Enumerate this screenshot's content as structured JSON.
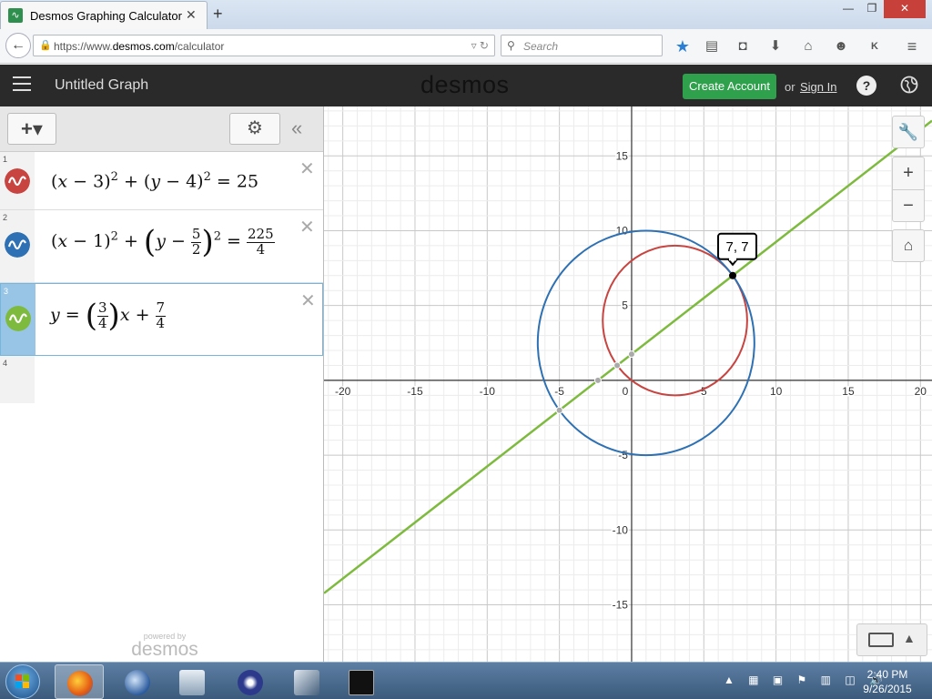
{
  "browser": {
    "tab_title": "Desmos Graphing Calculator",
    "tab_close": "✕",
    "new_tab": "+",
    "window_controls": {
      "minimize": "—",
      "maximize": "❐",
      "close": "✕"
    },
    "url_prefix": "https://www.",
    "url_domain": "desmos.com",
    "url_path": "/calculator",
    "search_placeholder": "Search",
    "toolbar_icons": [
      "bookmark-star-icon",
      "reading-list-icon",
      "pocket-icon",
      "download-icon",
      "home-icon",
      "chat-icon",
      "addon-icon",
      "menu-icon"
    ]
  },
  "desmos": {
    "graph_title": "Untitled Graph",
    "logo": "desmos",
    "create_account": "Create Account",
    "or": "or",
    "sign_in": "Sign In",
    "help": "?",
    "add_label": "+▾",
    "powered_by": "powered by",
    "powered_logo": "desmos"
  },
  "expressions": [
    {
      "index": "1",
      "color": "#c74440",
      "latex": "(x-3)^2+(y-4)^2=25",
      "active": false
    },
    {
      "index": "2",
      "color": "#2d70b3",
      "latex": "(x-1)^2+(y-5/2)^2=225/4",
      "active": false
    },
    {
      "index": "3",
      "color": "#7dba3e",
      "latex": "y=(3/4)x+7/4",
      "active": true
    },
    {
      "index": "4",
      "color": "",
      "latex": "",
      "active": false
    }
  ],
  "expr_text": {
    "e1": {
      "open1": "(",
      "x": "x",
      "minus3": " − 3)",
      "sq1": "2",
      "plus": " + (",
      "y": "y",
      "minus4": " − 4)",
      "sq2": "2",
      "eq": " = 25"
    },
    "e2": {
      "open1": "(",
      "x": "x",
      "minus1": " − 1)",
      "sq1": "2",
      "plus": " + ",
      "y": "y",
      "minus": " − ",
      "fnum": "5",
      "fden": "2",
      "sq2": "2",
      "eq": " = ",
      "rnum": "225",
      "rden": "4"
    },
    "e3": {
      "y": "y",
      "eq": " = ",
      "fnum": "3",
      "fden": "4",
      "x": "x",
      "plus": " + ",
      "cnum": "7",
      "cden": "4"
    }
  },
  "graph": {
    "xlim": [
      -21.3,
      20.8
    ],
    "ylim": [
      -18.8,
      18.3
    ],
    "grid_minor": 1,
    "grid_major": 5,
    "x_ticks": [
      "-20",
      "-15",
      "-10",
      "-5",
      "0",
      "5",
      "10",
      "15",
      "20"
    ],
    "y_ticks": [
      "15",
      "10",
      "5",
      "-5",
      "-10",
      "-15"
    ],
    "circles": [
      {
        "cx": 3,
        "cy": 4,
        "r": 5,
        "color": "#c74440"
      },
      {
        "cx": 1,
        "cy": 2.5,
        "r": 7.5,
        "color": "#2d70b3"
      }
    ],
    "line": {
      "slope": 0.75,
      "intercept": 1.75,
      "color": "#7dba3e"
    },
    "highlight_point": {
      "x": 7,
      "y": 7,
      "label": "7, 7"
    },
    "gray_points": [
      {
        "x": -5,
        "y": -2
      },
      {
        "x": -2.333,
        "y": 0
      },
      {
        "x": 0,
        "y": 1.75
      },
      {
        "x": -1,
        "y": 1
      }
    ]
  },
  "taskbar": {
    "time": "2:40 PM",
    "date": "9/26/2015",
    "apps": [
      "firefox-icon",
      "thunderbird-icon",
      "network-app-icon",
      "eclipse-icon",
      "installer-icon",
      "terminal-icon"
    ]
  }
}
